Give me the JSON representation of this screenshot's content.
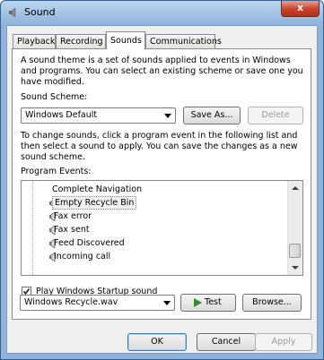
{
  "window": {
    "title": "Sound",
    "close_glyph": "x"
  },
  "tabs": [
    {
      "label": "Playback"
    },
    {
      "label": "Recording"
    },
    {
      "label": "Sounds",
      "active": true
    },
    {
      "label": "Communications"
    }
  ],
  "sounds_tab": {
    "intro": "A sound theme is a set of sounds applied to events in Windows and programs.  You can select an existing scheme or save one you have modified.",
    "scheme_label": "Sound Scheme:",
    "scheme_value": "Windows Default",
    "save_as_label": "Save As...",
    "delete_label": "Delete",
    "instructions": "To change sounds, click a program event in the following list and then select a sound to apply.  You can save the changes as a new sound scheme.",
    "events_label": "Program Events:",
    "events": [
      {
        "label": "Complete Navigation",
        "has_sound": false
      },
      {
        "label": "Empty Recycle Bin",
        "has_sound": true,
        "selected": true
      },
      {
        "label": "Fax error",
        "has_sound": true
      },
      {
        "label": "Fax sent",
        "has_sound": true
      },
      {
        "label": "Feed Discovered",
        "has_sound": true
      },
      {
        "label": "Incoming call",
        "has_sound": true
      }
    ],
    "startup_label": "Play Windows Startup sound",
    "startup_checked": true,
    "sounds_label": "Sounds:",
    "sound_value": "Windows Recycle.wav",
    "test_label": "Test",
    "browse_label": "Browse..."
  },
  "footer": {
    "ok_label": "OK",
    "cancel_label": "Cancel",
    "apply_label": "Apply"
  }
}
